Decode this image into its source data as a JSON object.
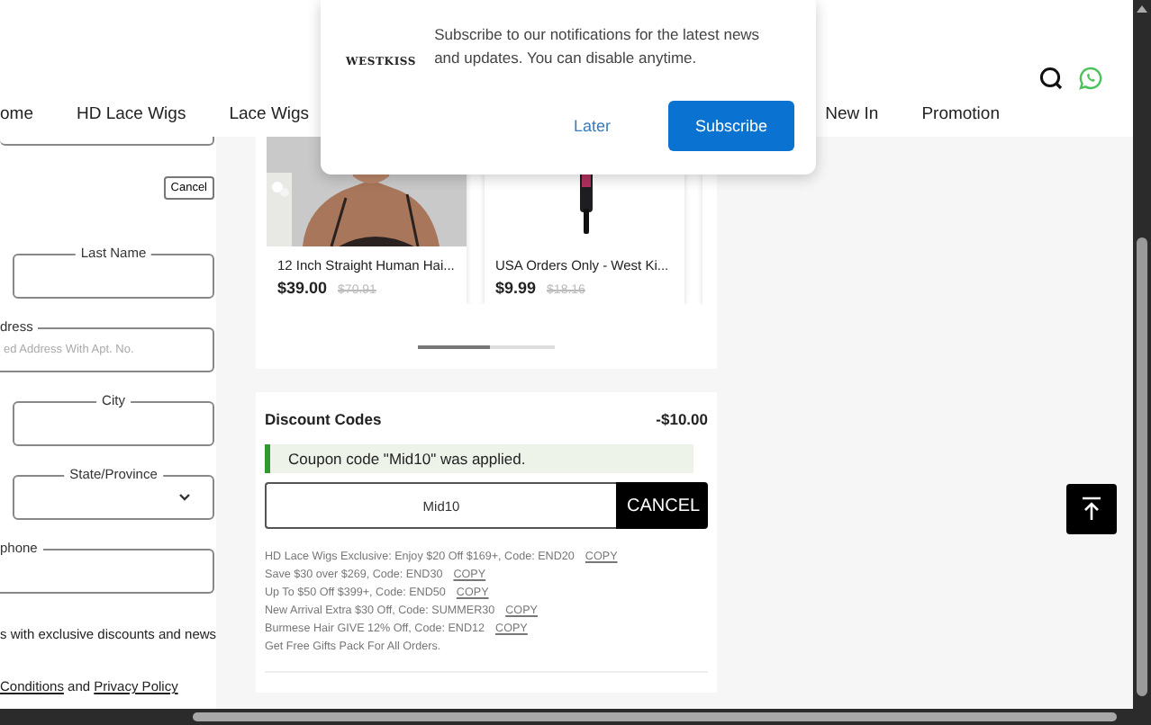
{
  "nav_left": [
    "ome",
    "HD Lace Wigs",
    "Lace Wigs"
  ],
  "nav_right": [
    "New In",
    "Promotion"
  ],
  "popup": {
    "logo": "WESTKISS",
    "message": "Subscribe to our notifications for the latest news and updates. You can disable anytime.",
    "buttons": [
      {
        "label": "Later",
        "kind": "text"
      },
      {
        "label": "Subscribe",
        "kind": "primary"
      }
    ]
  },
  "form": {
    "cancel": "Cancel",
    "fields": [
      {
        "label": "Last Name",
        "kind": "half"
      },
      {
        "label": "dress",
        "kind": "full",
        "placeholder": "ed Address With Apt. No."
      },
      {
        "label": "City",
        "kind": "half"
      },
      {
        "label": "State/Province",
        "kind": "select"
      },
      {
        "label": "phone",
        "kind": "full"
      }
    ],
    "news": "s with exclusive discounts and news",
    "terms": [
      {
        "text": "Conditions",
        "link": true
      },
      {
        "text": " and ",
        "link": false
      },
      {
        "text": "Privacy Policy",
        "link": true
      }
    ]
  },
  "products": [
    {
      "title": "12 Inch Straight Human Hai...",
      "price": "$39.00",
      "old_price": "$70.91",
      "kind": "picture"
    },
    {
      "title": "USA Orders Only - West Ki...",
      "price": "$9.99",
      "old_price": "$18.16",
      "kind": "picture"
    }
  ],
  "discount": {
    "title": "Discount Codes",
    "amount": "-$10.00",
    "notice": "Coupon code \"Mid10\" was applied.",
    "code": "Mid10",
    "cancel": "CANCEL",
    "offers": [
      {
        "text": "HD Lace Wigs Exclusive: Enjoy $20 Off $169+, Code: END20",
        "copy": "COPY"
      },
      {
        "text": "Save $30 over $269, Code: END30",
        "copy": "COPY"
      },
      {
        "text": "Up To $50 Off $399+, Code: END50",
        "copy": "COPY"
      },
      {
        "text": "New Arrival Extra $30 Off, Code: SUMMER30",
        "copy": "COPY"
      },
      {
        "text": "Burmese Hair GIVE 12% Off, Code: END12",
        "copy": "COPY"
      },
      {
        "text": "Get Free Gifts Pack For All Orders."
      }
    ]
  }
}
